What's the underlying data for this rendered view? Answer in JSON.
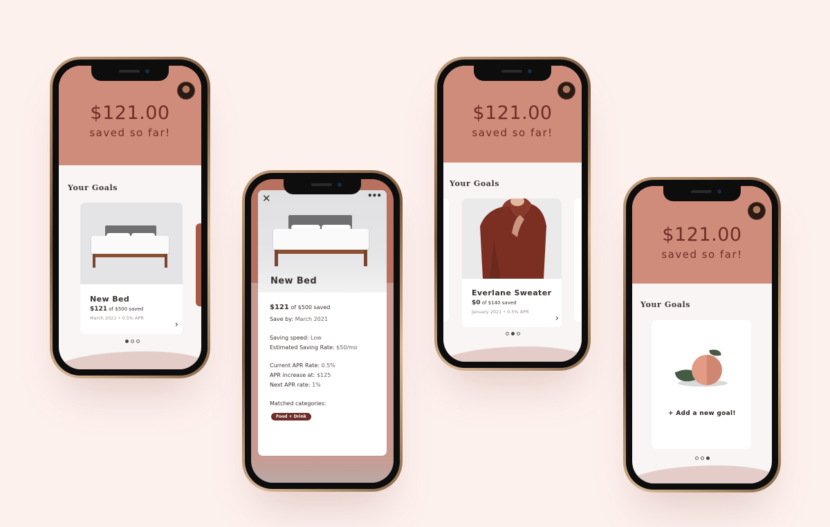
{
  "theme": {
    "background": "#fdf1ee",
    "header_color": "#d08c7b",
    "accent_text": "#6d2e27",
    "wave_color": "#e4cdc9"
  },
  "phone1": {
    "amount": "$121.00",
    "saved_label": "saved so far!",
    "goals_title": "Your Goals",
    "card": {
      "title": "New Bed",
      "progress_amount": "$121",
      "progress_rest": "of $500 saved",
      "meta": "March 2021 • 0.5% APR"
    },
    "active_dot": 0
  },
  "phone2": {
    "title": "New Bed",
    "progress_amount": "$121",
    "progress_rest": "of $500 saved",
    "save_by_label": "Save by:",
    "save_by_value": "March 2021",
    "speed_label": "Saving speed:",
    "speed_value": "Low",
    "rate_label": "Estimated Saving Rate:",
    "rate_value": "$50/mo",
    "apr_label": "Current APR Rate:",
    "apr_value": "0.5%",
    "increase_label": "APR increase at:",
    "increase_value": "$125",
    "next_label": "Next APR rate:",
    "next_value": "1%",
    "categories_label": "Matched categories:",
    "category_tag": "Food + Drink"
  },
  "phone3": {
    "amount": "$121.00",
    "saved_label": "saved so far!",
    "goals_title": "Your Goals",
    "card": {
      "title": "Everlane Sweater",
      "progress_amount": "$0",
      "progress_rest": "of $140 saved",
      "meta": "January 2021 • 0.5% APR"
    },
    "active_dot": 1
  },
  "phone4": {
    "amount": "$121.00",
    "saved_label": "saved so far!",
    "goals_title": "Your Goals",
    "add_goal": "+ Add a new goal!",
    "active_dot": 2
  },
  "icons": {
    "close": "close-icon",
    "more": "more-icon",
    "chevron": "chevron-right-icon",
    "avatar": "avatar",
    "peach": "peach-illustration"
  }
}
